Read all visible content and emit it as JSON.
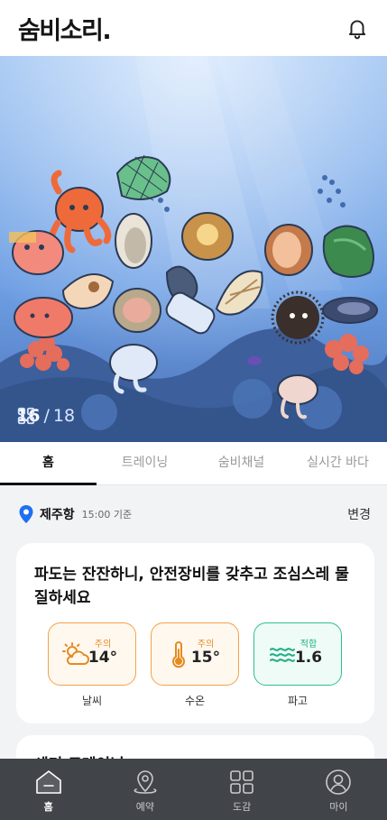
{
  "header": {
    "logo": "숨비소리.",
    "notification_icon": "bell-icon"
  },
  "hero": {
    "current_index": "16",
    "separator": "/",
    "total": "18",
    "counter_icon": "grid-icon"
  },
  "tabs": [
    {
      "label": "홈",
      "active": true
    },
    {
      "label": "트레이닝",
      "active": false
    },
    {
      "label": "숨비채널",
      "active": false
    },
    {
      "label": "실시간 바다",
      "active": false
    }
  ],
  "location": {
    "name": "제주항",
    "time": "15:00 기준",
    "change_label": "변경",
    "icon": "location-pin-icon"
  },
  "conditions": {
    "message": "파도는 잔잔하니, 안전장비를 갖추고 조심스레 물질하세요",
    "metrics": [
      {
        "status": "주의",
        "value": "14°",
        "label": "날씨",
        "icon": "cloud-sun-icon",
        "level": "caution"
      },
      {
        "status": "주의",
        "value": "15°",
        "label": "수온",
        "icon": "thermometer-icon",
        "level": "caution"
      },
      {
        "status": "적합",
        "value": "1.6",
        "label": "파고",
        "icon": "waves-icon",
        "level": "good"
      }
    ]
  },
  "next_card": {
    "title": "세미 트레이닝"
  },
  "bottom_nav": [
    {
      "label": "홈",
      "icon": "home-icon",
      "active": true
    },
    {
      "label": "예약",
      "icon": "map-pin-icon",
      "active": false
    },
    {
      "label": "도감",
      "icon": "grid-icon",
      "active": false
    },
    {
      "label": "마이",
      "icon": "profile-icon",
      "active": false
    }
  ],
  "colors": {
    "caution": "#f2a248",
    "good": "#2fbf93",
    "accent_blue": "#1f6ff2",
    "nav_bg": "#414449"
  }
}
